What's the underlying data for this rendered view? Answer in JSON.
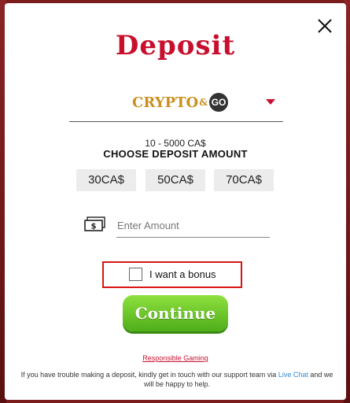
{
  "modal": {
    "title": "Deposit"
  },
  "payment_method": {
    "logo_text": "CRYPTO",
    "logo_amp": "&",
    "logo_go": "GO"
  },
  "deposit": {
    "range": "10 - 5000 CA$",
    "choose_label": "CHOOSE DEPOSIT AMOUNT",
    "amounts": [
      "30CA$",
      "50CA$",
      "70CA$"
    ]
  },
  "amount_input": {
    "placeholder": "Enter Amount",
    "value": ""
  },
  "bonus": {
    "label": "I want a bonus",
    "checked": false
  },
  "continue_label": "Continue",
  "responsible_link": "Responsible Gaming",
  "support": {
    "text": "If you have trouble making a deposit, kindly get in touch with our support team via",
    "chat_link": "Live Chat",
    "text_after": "and we will be happy to help."
  },
  "colors": {
    "brand_red": "#c8102e",
    "continue_green": "#5cbf22",
    "highlight_border": "#d81414",
    "link_blue": "#2a8ad8"
  }
}
